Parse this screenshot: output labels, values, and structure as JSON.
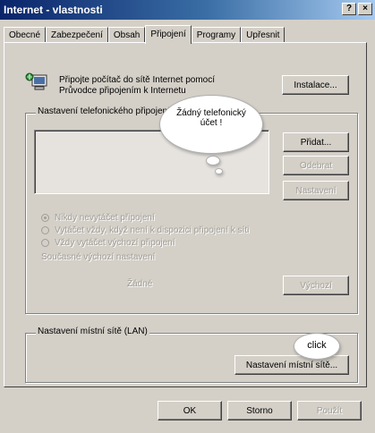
{
  "window": {
    "title": "Internet - vlastnosti",
    "help_btn": "?",
    "close_btn": "×"
  },
  "tabs": [
    {
      "label": "Obecné"
    },
    {
      "label": "Zabezpečení"
    },
    {
      "label": "Obsah"
    },
    {
      "label": "Připojení"
    },
    {
      "label": "Programy"
    },
    {
      "label": "Upřesnit"
    }
  ],
  "active_tab": "Připojení",
  "setup": {
    "text_line1": "Připojte počítač do sítě Internet pomocí",
    "text_line2": "Průvodce připojením k Internetu",
    "button": "Instalace..."
  },
  "dialup": {
    "group_label": "Nastavení telefonického připojení",
    "add_button": "Přidat...",
    "remove_button": "Odebrat",
    "settings_button": "Nastavení",
    "radio_never": "Nikdy nevytáčet připojení",
    "radio_when_none": "Vytáčet vždy, když není k dispozici připojení k síti",
    "radio_always": "Vždy vytáčet výchozí připojení",
    "current_default_label": "Současné výchozí nastavení",
    "current_default_value": "Žádné",
    "default_button": "Výchozí"
  },
  "lan": {
    "group_label": "Nastavení místní sítě (LAN)",
    "button": "Nastavení místní sítě..."
  },
  "footer": {
    "ok": "OK",
    "cancel": "Storno",
    "apply": "Použít"
  },
  "annotations": {
    "bubble_line1": "Žádný telefonický",
    "bubble_line2": "účet !",
    "click": "click"
  }
}
